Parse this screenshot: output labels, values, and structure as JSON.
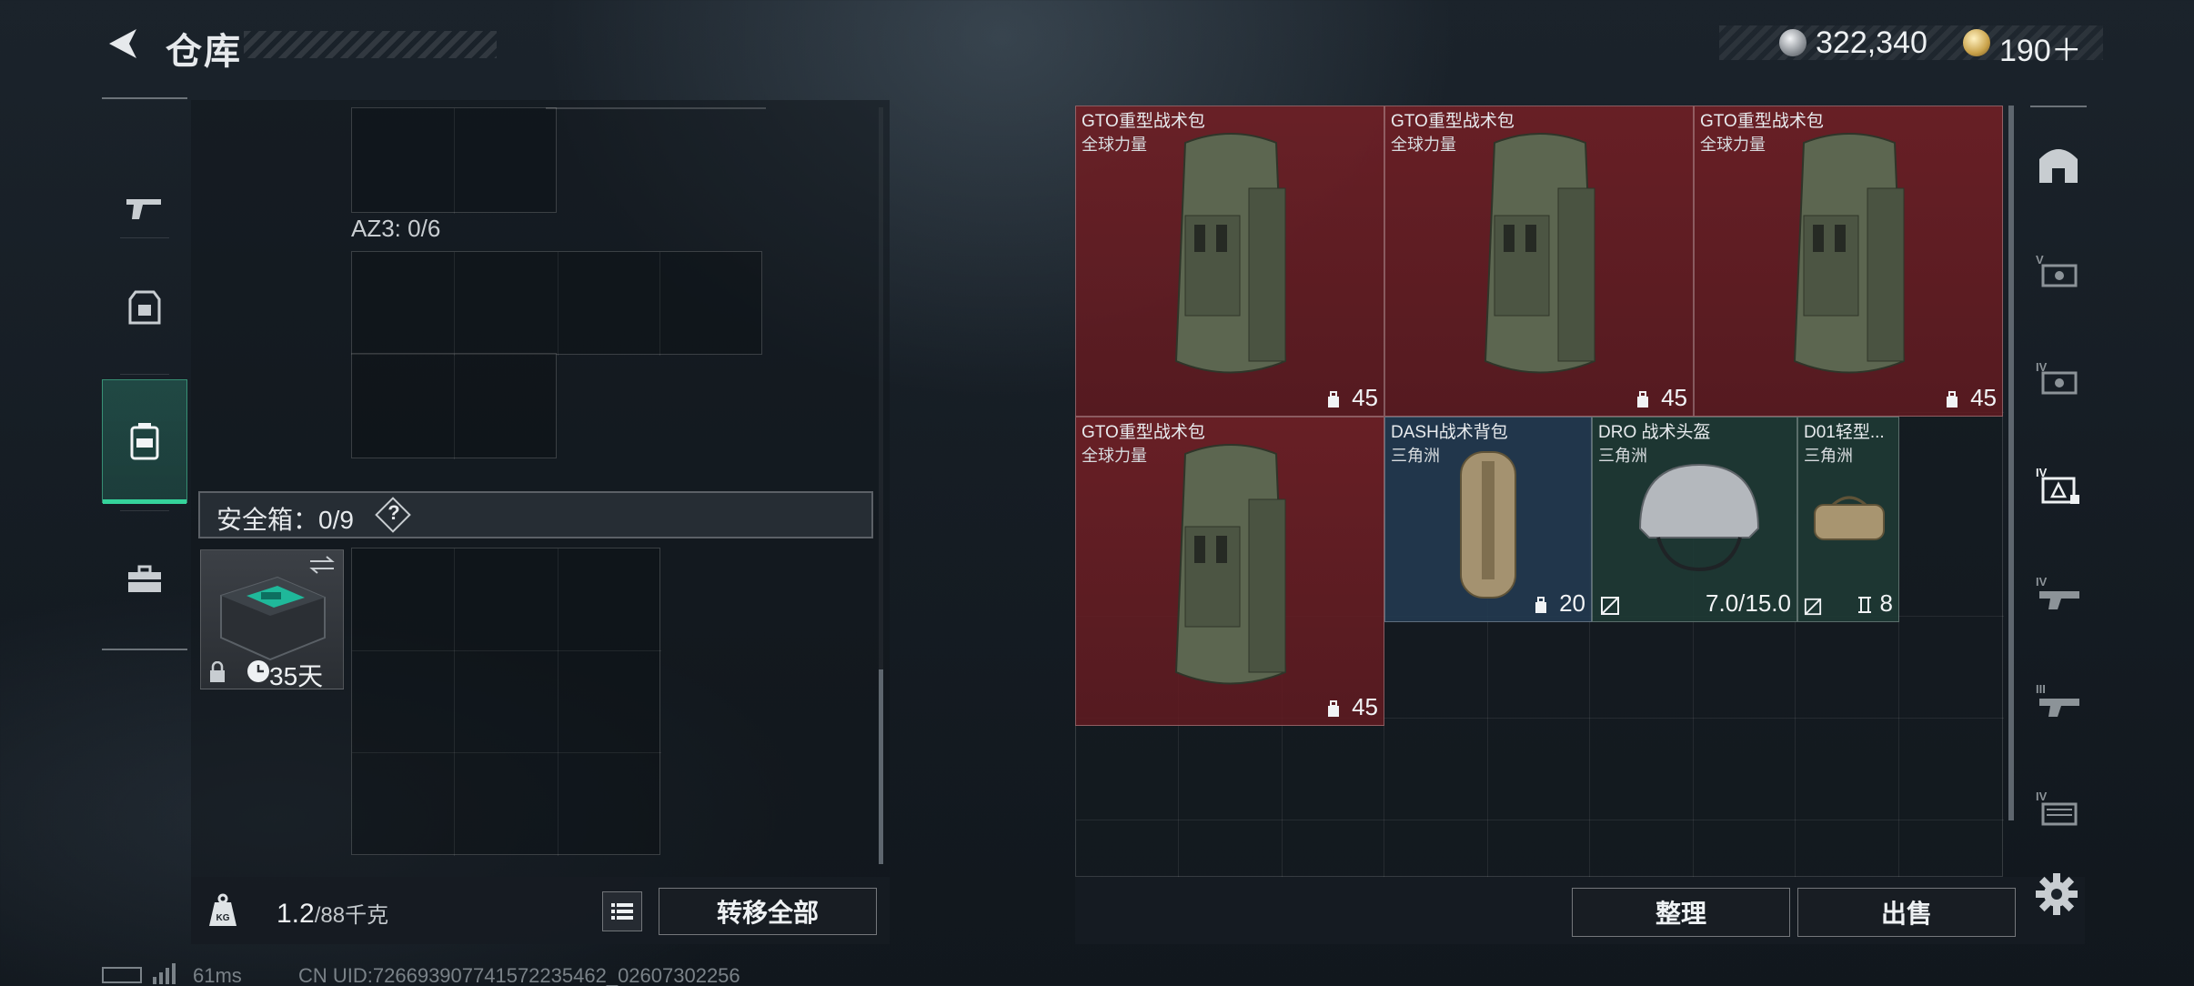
{
  "header": {
    "title": "仓库",
    "currency1": "322,340",
    "currency2": "190＋"
  },
  "left_tabs": [
    "pistol-icon",
    "armor-icon",
    "backpack-icon",
    "briefcase-icon"
  ],
  "container": {
    "az_label": "AZ3: 0/6",
    "safe_label": "安全箱：0/9",
    "help_symbol": "?",
    "safebox_days": "35天"
  },
  "bottom_left": {
    "weight_value": "1.2",
    "weight_cap": "/88千克",
    "transfer_label": "转移全部"
  },
  "stash_items": [
    {
      "name": "GTO重型战术包",
      "sub": "全球力量",
      "count": "45"
    },
    {
      "name": "GTO重型战术包",
      "sub": "全球力量",
      "count": "45"
    },
    {
      "name": "GTO重型战术包",
      "sub": "全球力量",
      "count": "45"
    },
    {
      "name": "GTO重型战术包",
      "sub": "全球力量",
      "count": "45"
    },
    {
      "name": "DASH战术背包",
      "sub": "三角洲",
      "count": "20"
    },
    {
      "name": "DRO 战术头盔",
      "sub": "三角洲",
      "count": "7.0/15.0"
    },
    {
      "name": "D01轻型...",
      "sub": "三角洲",
      "count": "8"
    }
  ],
  "bottom_right": {
    "sort_label": "整理",
    "sell_label": "出售"
  },
  "right_tabs": [
    "vault-icon",
    "tier-v-icon",
    "tier-iv-icon",
    "tier-iv-locked-icon",
    "tier-iv-gun-icon",
    "tier-iii-gun-icon",
    "tier-iv-box-icon"
  ],
  "status": {
    "ping": "61ms",
    "uid": "CN UID:726693907741572235462_02607302256"
  },
  "colors": {
    "accent": "#35d39b",
    "rare_red": "#762026",
    "rare_blue": "#223a50",
    "rare_green": "#1e3a34"
  }
}
